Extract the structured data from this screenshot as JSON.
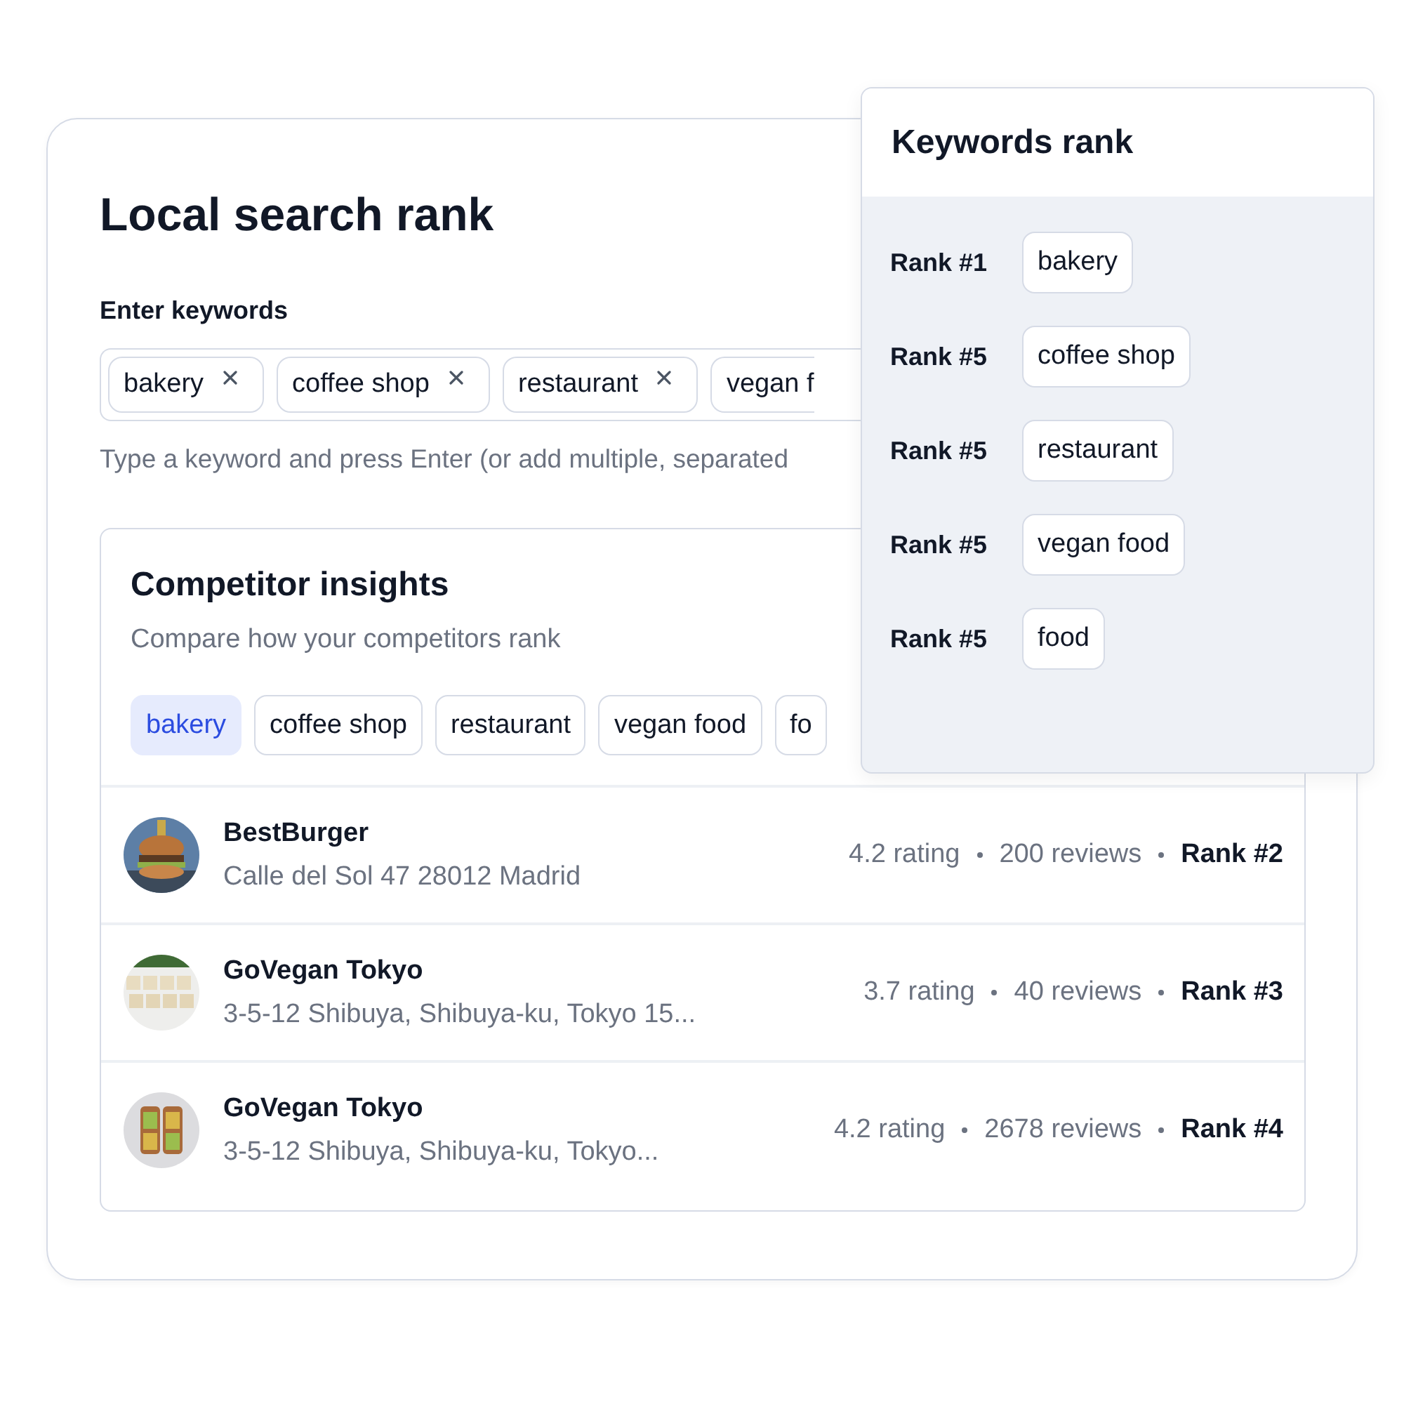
{
  "page": {
    "title": "Local search rank"
  },
  "keywords": {
    "label": "Enter keywords",
    "chips": [
      {
        "text": "bakery"
      },
      {
        "text": "coffee shop"
      },
      {
        "text": "restaurant"
      },
      {
        "text": "vegan f"
      }
    ],
    "hint": "Type a keyword and press Enter (or add multiple, separated"
  },
  "competitors": {
    "title": "Competitor insights",
    "subtitle": "Compare how your competitors rank",
    "tabs": [
      {
        "label": "bakery",
        "selected": true
      },
      {
        "label": "coffee shop",
        "selected": false
      },
      {
        "label": "restaurant",
        "selected": false
      },
      {
        "label": "vegan food",
        "selected": false
      },
      {
        "label": "fo",
        "selected": false
      }
    ],
    "rows": [
      {
        "kind": "burger",
        "name": "BestBurger",
        "address": "Calle del Sol 47 28012 Madrid",
        "rating": "4.2 rating",
        "reviews": "200 reviews",
        "rank": "Rank #2"
      },
      {
        "kind": "tiles",
        "name": "GoVegan Tokyo",
        "address": "3-5-12 Shibuya, Shibuya-ku, Tokyo 15...",
        "rating": "3.7 rating",
        "reviews": "40 reviews",
        "rank": "Rank #3"
      },
      {
        "kind": "boxes",
        "name": "GoVegan Tokyo",
        "address": "3-5-12 Shibuya, Shibuya-ku, Tokyo...",
        "rating": "4.2 rating",
        "reviews": "2678 reviews",
        "rank": "Rank #4"
      }
    ]
  },
  "keywords_rank": {
    "title": "Keywords rank",
    "items": [
      {
        "rank": "Rank #1",
        "keyword": "bakery"
      },
      {
        "rank": "Rank #5",
        "keyword": "coffee shop"
      },
      {
        "rank": "Rank #5",
        "keyword": "restaurant"
      },
      {
        "rank": "Rank #5",
        "keyword": "vegan food"
      },
      {
        "rank": "Rank #5",
        "keyword": "food"
      }
    ]
  }
}
